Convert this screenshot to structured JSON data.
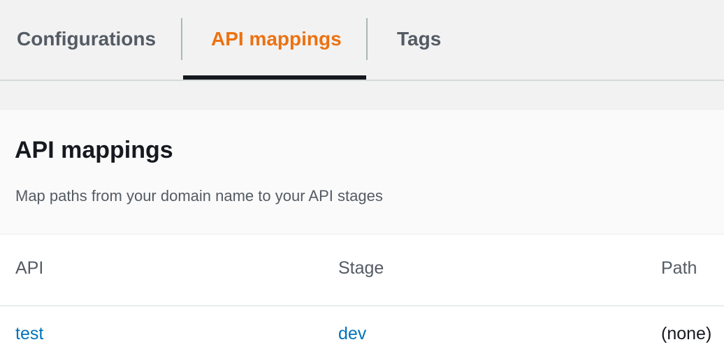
{
  "tabs": [
    {
      "label": "Configurations",
      "active": false
    },
    {
      "label": "API mappings",
      "active": true
    },
    {
      "label": "Tags",
      "active": false
    }
  ],
  "colors": {
    "active_tab": "#ec7211",
    "link": "#0073bb",
    "text": "#16191f",
    "muted_text": "#545b64"
  },
  "panel": {
    "title": "API mappings",
    "description": "Map paths from your domain name to your API stages"
  },
  "table": {
    "columns": [
      "API",
      "Stage",
      "Path"
    ],
    "rows": [
      {
        "api": "test",
        "stage": "dev",
        "path": "(none)"
      }
    ]
  }
}
